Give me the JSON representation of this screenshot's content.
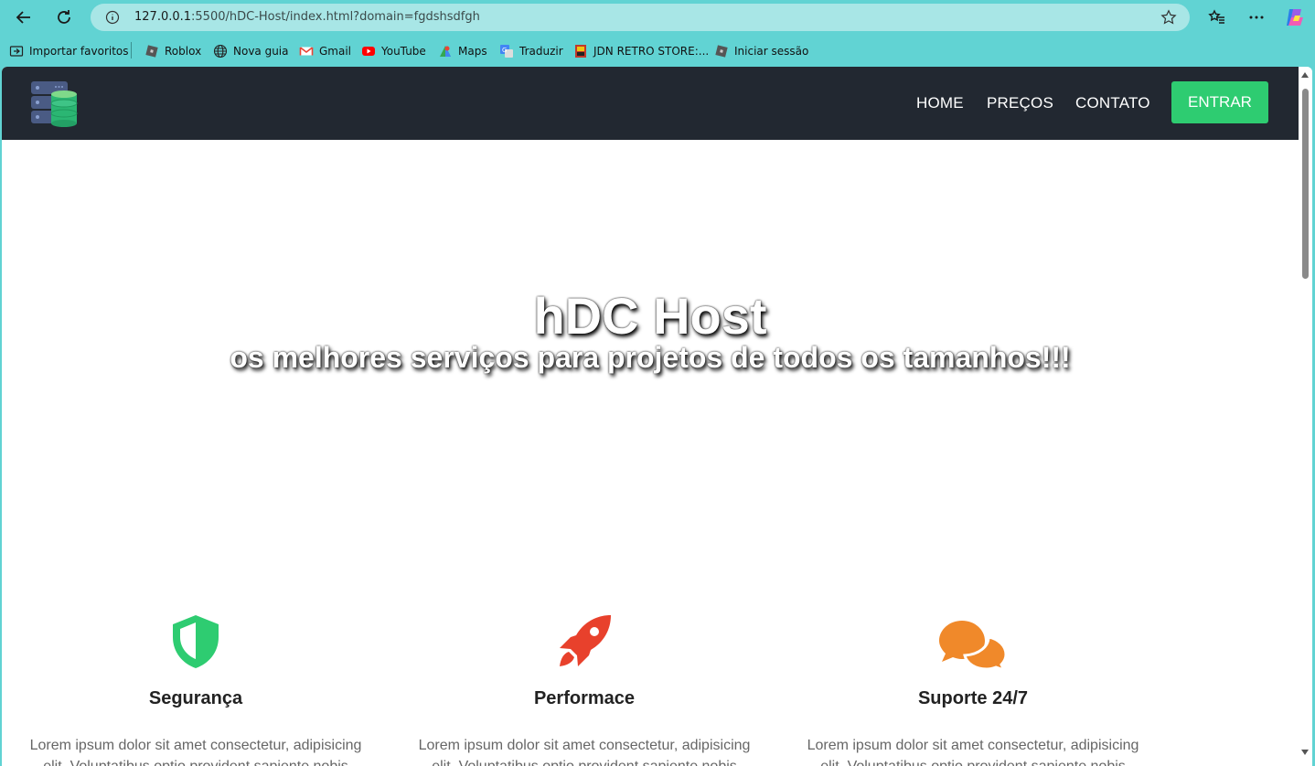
{
  "browser": {
    "url_host": "127.0.0.1",
    "url_rest": ":5500/hDC-Host/index.html?domain=fgdshsdfgh",
    "bookmarks": [
      {
        "label": "Importar favoritos",
        "icon": "import-favorites-icon"
      },
      {
        "label": "Roblox",
        "icon": "roblox-icon"
      },
      {
        "label": "Nova guia",
        "icon": "globe-icon"
      },
      {
        "label": "Gmail",
        "icon": "gmail-icon"
      },
      {
        "label": "YouTube",
        "icon": "youtube-icon"
      },
      {
        "label": "Maps",
        "icon": "maps-icon"
      },
      {
        "label": "Traduzir",
        "icon": "translate-icon"
      },
      {
        "label": "JDN RETRO STORE:...",
        "icon": "jdn-store-icon"
      },
      {
        "label": "Iniciar sessão",
        "icon": "roblox-icon"
      }
    ]
  },
  "site": {
    "nav": {
      "home": "HOME",
      "precos": "PREÇOS",
      "contato": "CONTATO",
      "entrar": "ENTRAR"
    },
    "hero": {
      "title": "hDC Host",
      "subtitle": "os melhores serviços para projetos de todos os tamanhos!!!"
    },
    "features": [
      {
        "title": "Segurança",
        "icon": "shield-icon",
        "text": "Lorem ipsum dolor sit amet consectetur, adipisicing elit. Voluptatibus optio provident sapiente nobis"
      },
      {
        "title": "Performace",
        "icon": "rocket-icon",
        "text": "Lorem ipsum dolor sit amet consectetur, adipisicing elit. Voluptatibus optio provident sapiente nobis"
      },
      {
        "title": "Suporte 24/7",
        "icon": "chat-bubbles-icon",
        "text": "Lorem ipsum dolor sit amet consectetur, adipisicing elit. Voluptatibus optio provident sapiente nobis"
      }
    ]
  },
  "colors": {
    "browser_frame": "#61d3d3",
    "navbar": "#222831",
    "accent_green": "#2ecc71",
    "rocket_red": "#e8412c",
    "chat_orange": "#f0892a"
  }
}
